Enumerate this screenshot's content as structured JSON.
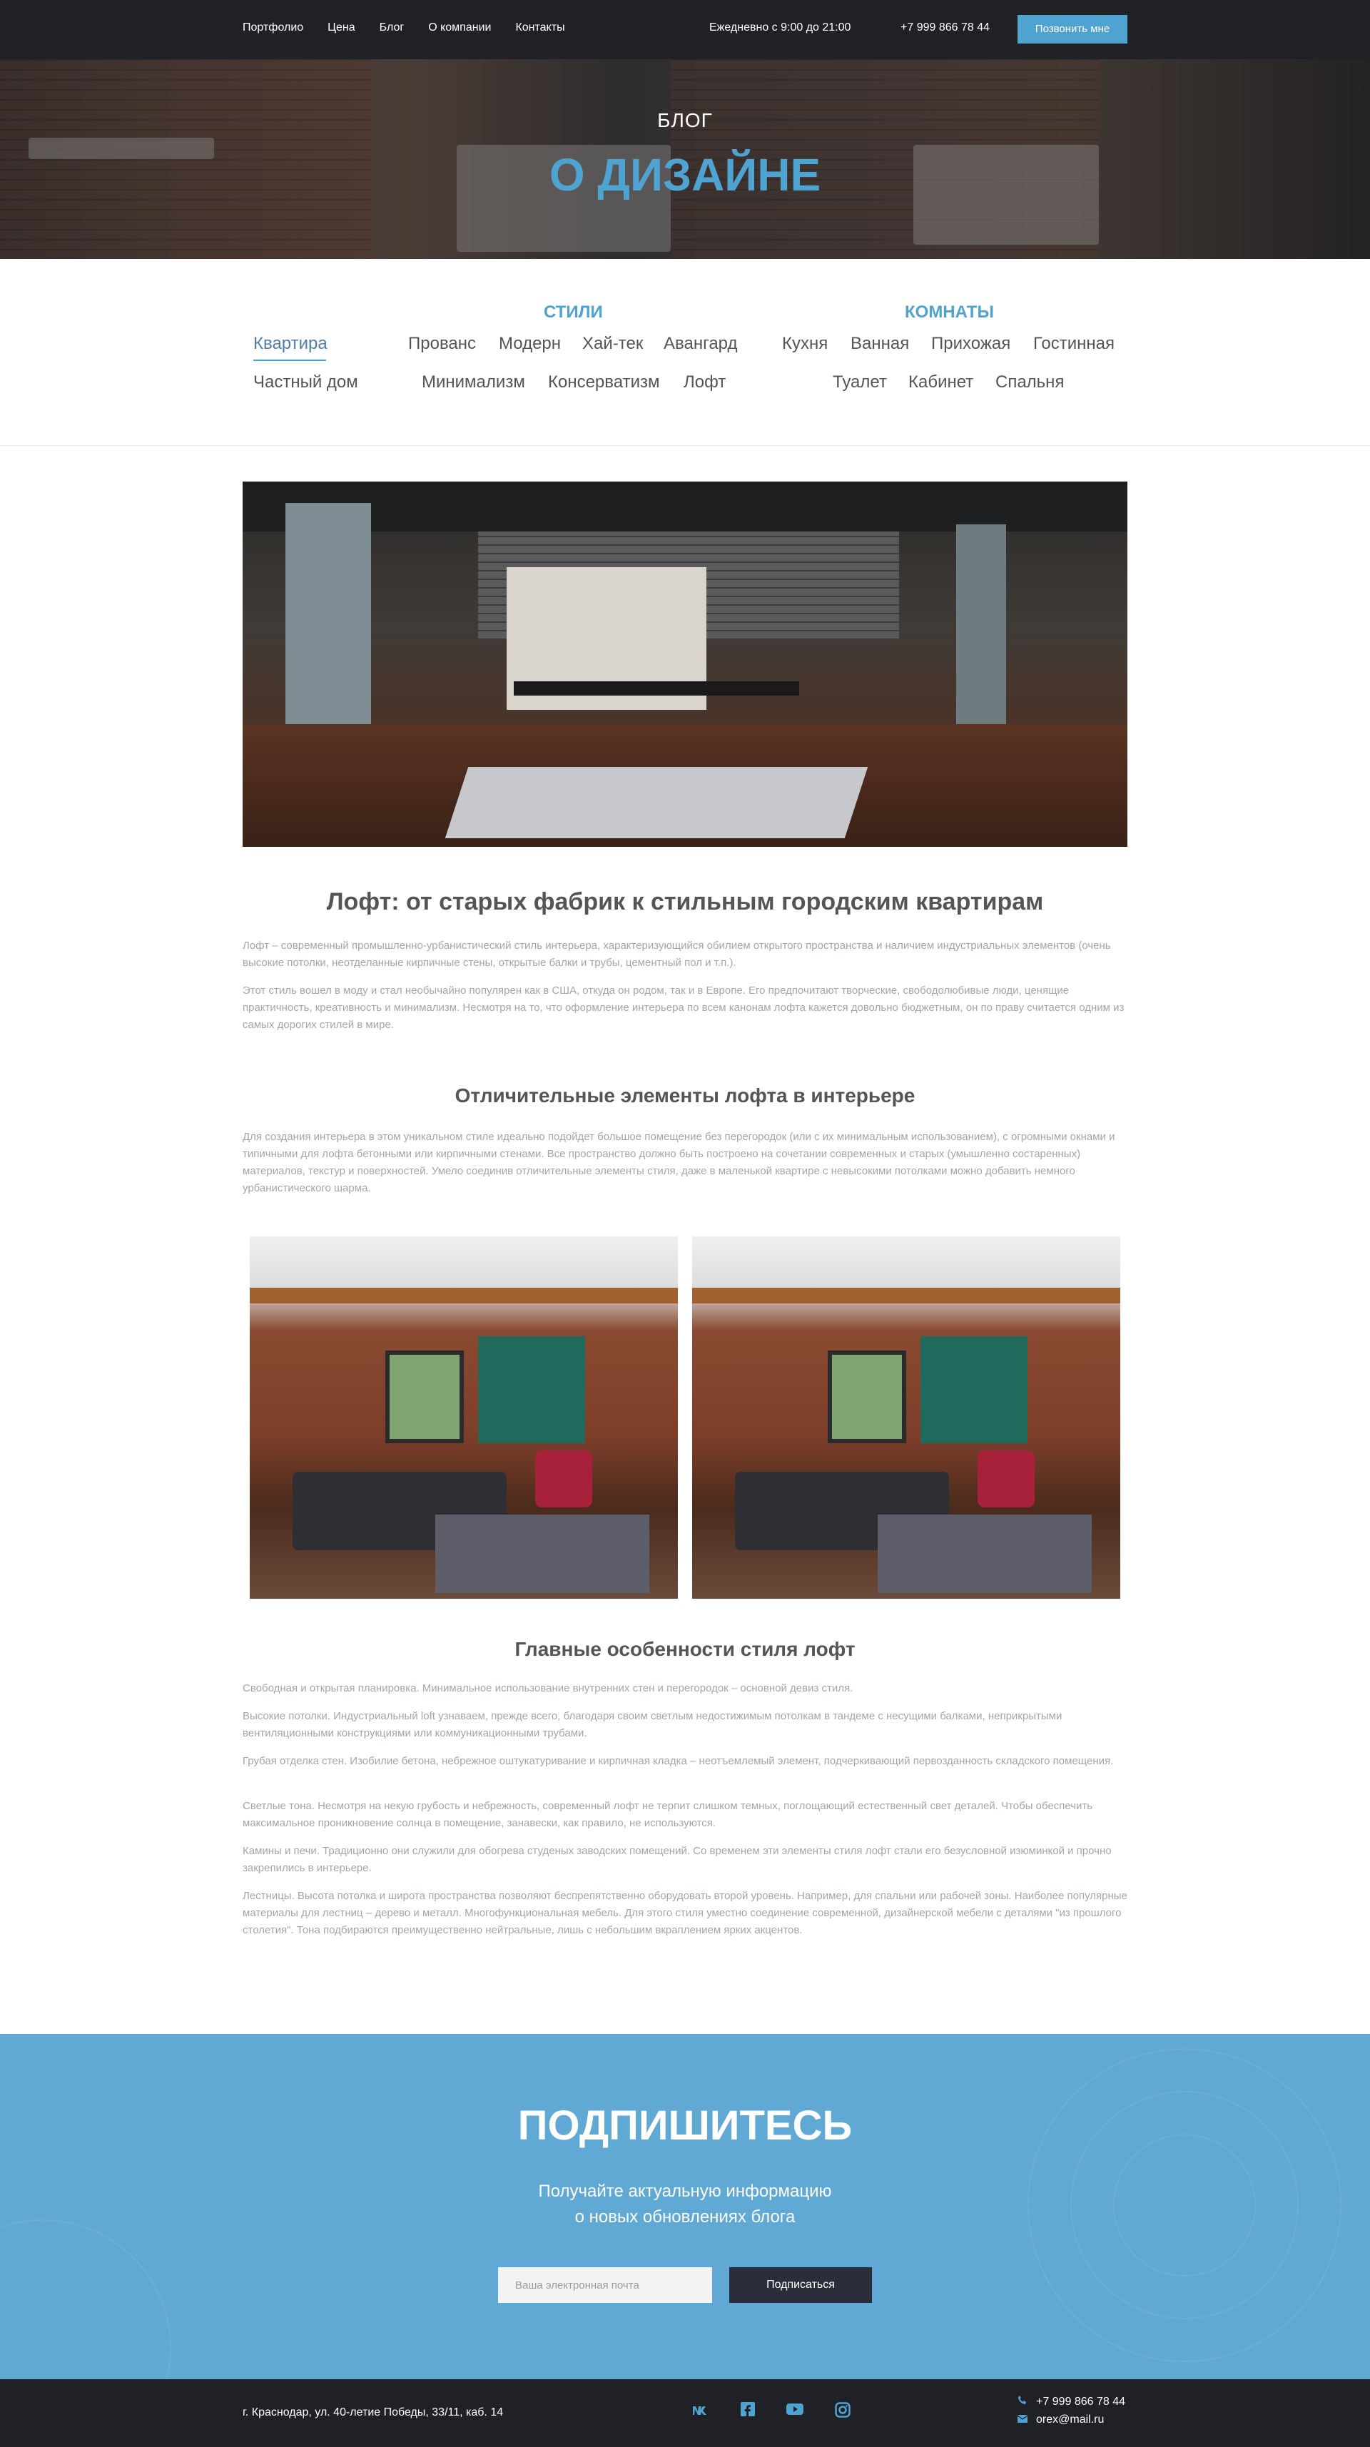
{
  "header": {
    "nav": [
      "Портфолио",
      "Цена",
      "Блог",
      "О компании",
      "Контакты"
    ],
    "hours": "Ежедневно с 9:00 до 21:00",
    "phone": "+7 999 866 78 44",
    "call_button": "Позвонить мне"
  },
  "hero": {
    "subtitle": "БЛОГ",
    "title": "О ДИЗАЙНЕ"
  },
  "categories": {
    "styles_heading": "СТИЛИ",
    "rooms_heading": "КОМНАТЫ",
    "general": [
      "Квартира",
      "Частный дом"
    ],
    "styles_row1": [
      "Прованс",
      "Модерн",
      "Хай-тек",
      "Авангард"
    ],
    "styles_row2": [
      "Минимализм",
      "Консерватизм",
      "Лофт"
    ],
    "rooms_row1": [
      "Кухня",
      "Ванная",
      "Прихожая",
      "Гостинная"
    ],
    "rooms_row2": [
      "Туалет",
      "Кабинет",
      "Спальня"
    ]
  },
  "article": {
    "title": "Лофт: от старых фабрик к стильным городским квартирам",
    "intro": [
      "Лофт – современный промышленно-урбанистический стиль интерьера, характеризующийся обилием открытого пространства и наличием индустриальных элементов (очень высокие потолки, неотделанные кирпичные стены, открытые балки и трубы, цементный пол и т.п.).",
      "Этот стиль вошел в моду и стал необычайно популярен как в США, откуда он родом, так и в Европе. Его предпочитают творческие, свободолюбивые люди, ценящие практичность, креативность и минимализм. Несмотря на то, что оформление интерьера по всем канонам лофта кажется довольно бюджетным, он по праву считается одним из самых дорогих стилей в мире."
    ],
    "section1_title": "Отличительные элементы лофта в интерьере",
    "section1_text": "Для создания интерьера в этом уникальном стиле идеально подойдет большое помещение без перегородок (или с их минимальным использованием), с огромными окнами и типичными для лофта бетонными или кирпичными стенами. Все пространство должно быть построено на сочетании современных и старых (умышленно состаренных) материалов, текстур и поверхностей. Умело соединив отличительные элементы стиля, даже в маленькой квартире с невысокими потолками можно добавить немного урбанистического шарма.",
    "section2_title": "Главные особенности стиля лофт",
    "features": [
      "Свободная и открытая планировка. Минимальное использование внутренних стен и перегородок – основной девиз стиля.",
      "Высокие потолки. Индустриальный loft узнаваем, прежде всего, благодаря своим светлым недостижимым потолкам в тандеме с несущими балками, неприкрытыми вентиляционными конструкциями или коммуникационными трубами.",
      "Грубая отделка стен. Изобилие бетона, небрежное оштукатуривание и кирпичная кладка – неотъемлемый элемент, подчеркивающий первозданность складского помещения.",
      "Светлые тона. Несмотря на некую грубость и небрежность, современный лофт не терпит слишком темных, поглощающий естественный свет деталей. Чтобы обеспечить максимальное проникновение солнца в помещение, занавески, как правило, не используются.",
      "Камины и печи. Традиционно они служили для обогрева студеных заводских помещений. Со временем эти элементы стиля лофт стали его безусловной изюминкой и прочно закрепились в интерьере.",
      "Лестницы. Высота потолка и широта пространства позволяют беспрепятственно оборудовать второй уровень. Например, для спальни или рабочей зоны. Наиболее популярные материалы для лестниц – дерево и металл. Многофункциональная мебель. Для этого стиля уместно соединение современной, дизайнерской мебели с деталями \"из прошлого столетия\". Тона подбираются преимущественно нейтральные, лишь с небольшим вкраплением ярких акцентов."
    ]
  },
  "subscribe": {
    "title": "ПОДПИШИТЕСЬ",
    "line1": "Получайте актуальную информацию",
    "line2": "о новых обновлениях блога",
    "placeholder": "Ваша электронная почта",
    "button": "Подписаться"
  },
  "footer": {
    "address": "г. Краснодар, ул. 40-летие Победы, 33/11, каб. 14",
    "social": [
      "vk-icon",
      "facebook-icon",
      "youtube-icon",
      "instagram-icon"
    ],
    "phone": "+7 999 866 78 44",
    "email": "orex@mail.ru"
  },
  "colors": {
    "accent": "#4fa3d1",
    "dark": "#1f2127",
    "subscribe_bg": "#5fa9d4"
  }
}
